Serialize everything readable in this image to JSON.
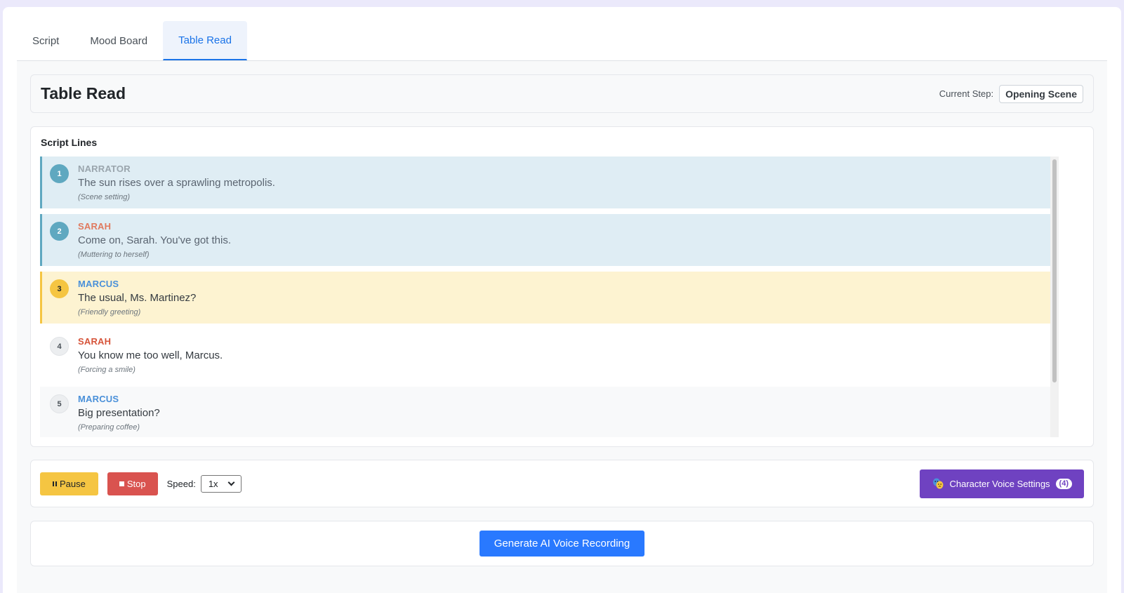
{
  "tabs": [
    {
      "label": "Script",
      "active": false
    },
    {
      "label": "Mood Board",
      "active": false
    },
    {
      "label": "Table Read",
      "active": true
    }
  ],
  "header": {
    "title": "Table Read",
    "current_step_label": "Current Step:",
    "current_step_value": "Opening Scene"
  },
  "script_lines": {
    "title": "Script Lines",
    "items": [
      {
        "number": "1",
        "speaker": "NARRATOR",
        "speaker_color": "#9aa5ad",
        "text": "The sun rises over a sprawling metropolis.",
        "direction": "(Scene setting)",
        "state": "done"
      },
      {
        "number": "2",
        "speaker": "SARAH",
        "speaker_color": "#e07a5f",
        "text": "Come on, Sarah. You've got this.",
        "direction": "(Muttering to herself)",
        "state": "done"
      },
      {
        "number": "3",
        "speaker": "MARCUS",
        "speaker_color": "#4a90d9",
        "text": "The usual, Ms. Martinez?",
        "direction": "(Friendly greeting)",
        "state": "current"
      },
      {
        "number": "4",
        "speaker": "SARAH",
        "speaker_color": "#d6543a",
        "text": "You know me too well, Marcus.",
        "direction": "(Forcing a smile)",
        "state": "pending"
      },
      {
        "number": "5",
        "speaker": "MARCUS",
        "speaker_color": "#4a90d9",
        "text": "Big presentation?",
        "direction": "(Preparing coffee)",
        "state": "pending"
      }
    ]
  },
  "controls": {
    "pause_label": "Pause",
    "stop_label": "Stop",
    "speed_label": "Speed:",
    "speed_value": "1x",
    "voice_settings_label": "Character Voice Settings",
    "voice_settings_count": "(4)"
  },
  "generate": {
    "label": "Generate AI Voice Recording"
  },
  "colors": {
    "accent": "#1a73e8",
    "pause": "#f5c542",
    "stop": "#d9534f",
    "voice": "#6f42c1",
    "generate": "#2979ff",
    "done_line": "#dfedf4",
    "current_line": "#fdf3d1"
  }
}
